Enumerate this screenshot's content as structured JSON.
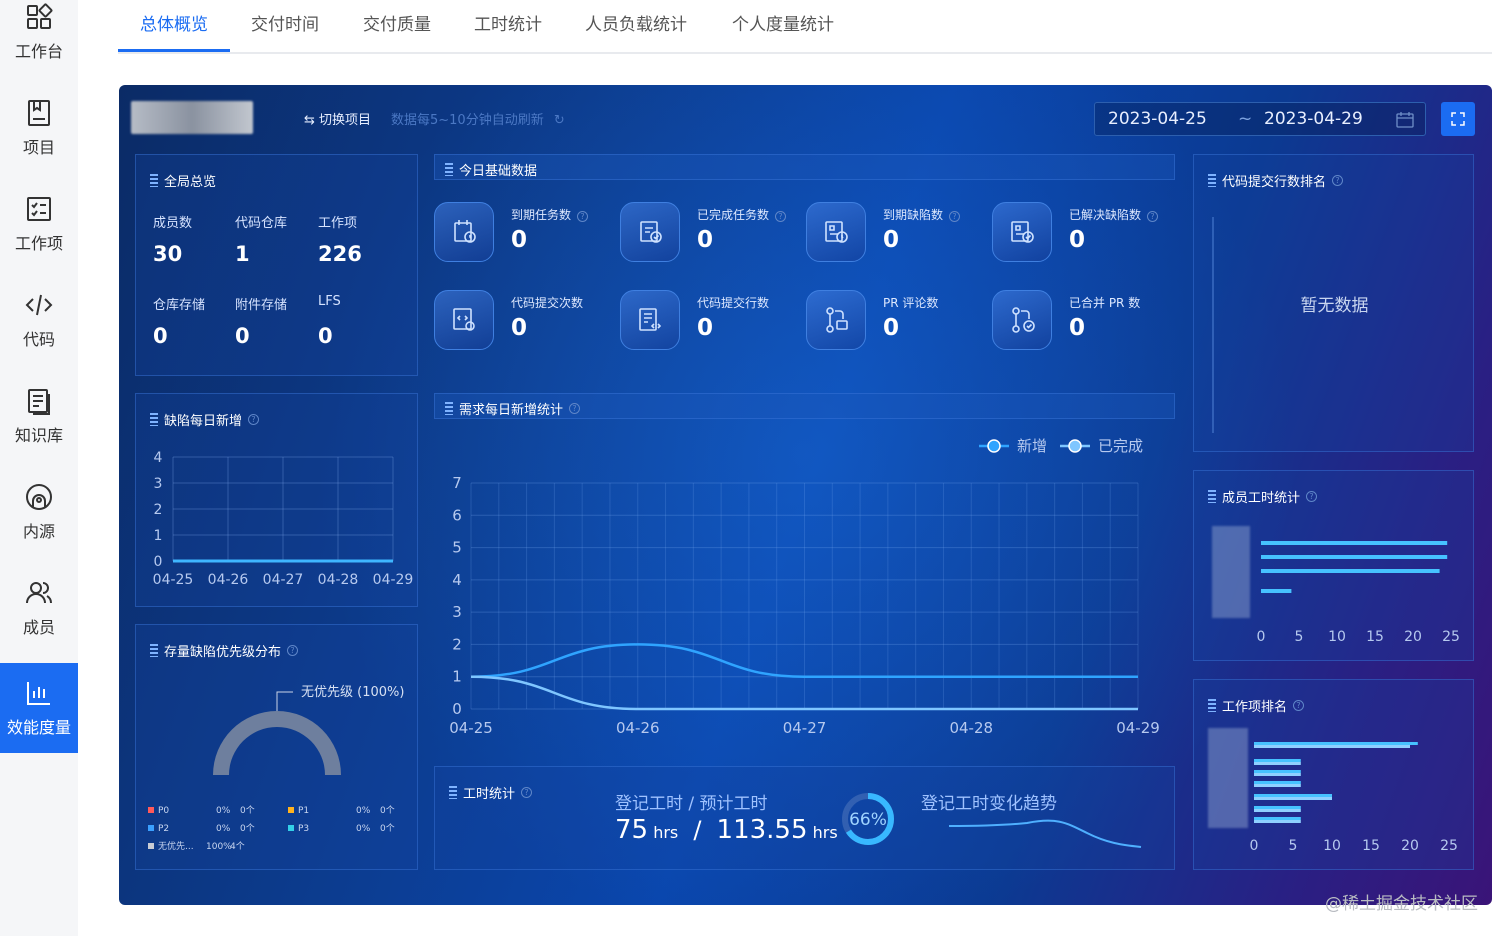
{
  "sidebar": {
    "items": [
      {
        "label": "工作台",
        "icon": "workbench-icon"
      },
      {
        "label": "项目",
        "icon": "project-icon"
      },
      {
        "label": "工作项",
        "icon": "workitem-icon"
      },
      {
        "label": "代码",
        "icon": "code-icon"
      },
      {
        "label": "知识库",
        "icon": "knowledge-icon"
      },
      {
        "label": "内源",
        "icon": "innersource-icon"
      },
      {
        "label": "成员",
        "icon": "members-icon"
      },
      {
        "label": "效能度量",
        "icon": "metrics-icon",
        "active": true
      }
    ]
  },
  "tabs": [
    "总体概览",
    "交付时间",
    "交付质量",
    "工时统计",
    "人员负载统计",
    "个人度量统计"
  ],
  "active_tab": "总体概览",
  "header": {
    "switch_label": "⇆ 切换项目",
    "refresh_text": "数据每5~10分钟自动刷新",
    "date_start": "2023-04-25",
    "date_sep": "~",
    "date_end": "2023-04-29"
  },
  "overview": {
    "title": "全局总览",
    "stats": [
      {
        "label": "成员数",
        "value": "30"
      },
      {
        "label": "代码仓库",
        "value": "1"
      },
      {
        "label": "工作项",
        "value": "226"
      },
      {
        "label": "仓库存储",
        "value": "0"
      },
      {
        "label": "附件存储",
        "value": "0"
      },
      {
        "label": "LFS",
        "value": "0"
      }
    ]
  },
  "today": {
    "title": "今日基础数据",
    "kpis": [
      {
        "label": "到期任务数",
        "value": "0",
        "icon": "task-due-icon",
        "help": true
      },
      {
        "label": "已完成任务数",
        "value": "0",
        "icon": "task-done-icon",
        "help": true
      },
      {
        "label": "到期缺陷数",
        "value": "0",
        "icon": "bug-due-icon",
        "help": true
      },
      {
        "label": "已解决缺陷数",
        "value": "0",
        "icon": "bug-resolved-icon",
        "help": true
      },
      {
        "label": "代码提交次数",
        "value": "0",
        "icon": "commit-count-icon",
        "help": false
      },
      {
        "label": "代码提交行数",
        "value": "0",
        "icon": "commit-lines-icon",
        "help": false
      },
      {
        "label": "PR 评论数",
        "value": "0",
        "icon": "pr-comment-icon",
        "help": false
      },
      {
        "label": "已合并 PR 数",
        "value": "0",
        "icon": "pr-merged-icon",
        "help": false
      }
    ]
  },
  "commit_rank": {
    "title": "代码提交行数排名",
    "empty_text": "暂无数据"
  },
  "defect_daily": {
    "title": "缺陷每日新增"
  },
  "demand_daily": {
    "title": "需求每日新增统计",
    "legend": [
      "新增",
      "已完成"
    ]
  },
  "member_hours": {
    "title": "成员工时统计"
  },
  "work_rank": {
    "title": "工作项排名"
  },
  "priority": {
    "title": "存量缺陷优先级分布",
    "callout": "无优先级 (100%)",
    "legend": [
      {
        "name": "P0",
        "pct": "0%",
        "count": "0个",
        "color": "#ff5a5a"
      },
      {
        "name": "P1",
        "pct": "0%",
        "count": "0个",
        "color": "#ffb21f"
      },
      {
        "name": "P2",
        "pct": "0%",
        "count": "0个",
        "color": "#3aa0ff"
      },
      {
        "name": "P3",
        "pct": "0%",
        "count": "0个",
        "color": "#33d0e8"
      },
      {
        "name": "无优先...",
        "pct": "100%",
        "count": "4个",
        "color": "#c8ccd4"
      }
    ]
  },
  "worktime": {
    "title": "工时统计",
    "label": "登记工时 / 预计工时",
    "registered": "75",
    "estimated": "113.55",
    "unit": "hrs",
    "slash": "/",
    "percent": "66%",
    "percent_value": 0.66,
    "trend_label": "登记工时变化趋势"
  },
  "watermark": "@稀土掘金技术社区",
  "chart_data": [
    {
      "type": "line",
      "title": "缺陷每日新增",
      "categories": [
        "04-25",
        "04-26",
        "04-27",
        "04-28",
        "04-29"
      ],
      "series": [
        {
          "values": [
            0,
            0,
            0,
            0,
            0
          ]
        }
      ],
      "ylim": [
        0,
        4
      ],
      "yticks": [
        0,
        1,
        2,
        3,
        4
      ],
      "grid": true
    },
    {
      "type": "line",
      "title": "需求每日新增统计",
      "categories": [
        "04-25",
        "04-26",
        "04-27",
        "04-28",
        "04-29"
      ],
      "series": [
        {
          "name": "新增",
          "values": [
            1,
            2,
            1,
            1,
            1
          ]
        },
        {
          "name": "已完成",
          "values": [
            1,
            0,
            0,
            0,
            0
          ]
        }
      ],
      "ylim": [
        0,
        7
      ],
      "yticks": [
        0,
        1,
        2,
        3,
        4,
        5,
        6,
        7
      ],
      "grid": true,
      "legend": "top-right"
    },
    {
      "type": "bar",
      "title": "成员工时统计",
      "orientation": "horizontal",
      "values": [
        24.5,
        24.5,
        23.5,
        4
      ],
      "xlim": [
        0,
        25
      ],
      "xticks": [
        0,
        5,
        10,
        15,
        20,
        25
      ]
    },
    {
      "type": "bar",
      "title": "工作项排名",
      "orientation": "horizontal",
      "series": [
        {
          "values": [
            21,
            6,
            6,
            6,
            10,
            6,
            6
          ]
        },
        {
          "values": [
            20,
            6,
            6,
            6,
            10,
            6,
            6
          ]
        }
      ],
      "xlim": [
        0,
        25
      ],
      "xticks": [
        0,
        5,
        10,
        15,
        20,
        25
      ]
    },
    {
      "type": "pie",
      "title": "存量缺陷优先级分布",
      "categories": [
        "P0",
        "P1",
        "P2",
        "P3",
        "无优先级"
      ],
      "values": [
        0,
        0,
        0,
        0,
        100
      ]
    }
  ]
}
